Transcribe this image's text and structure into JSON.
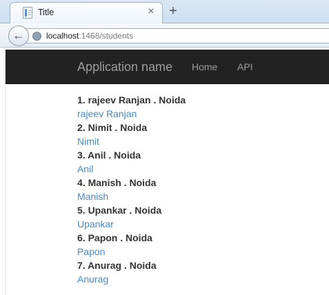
{
  "browser": {
    "tab_title": "Title",
    "tab_close": "×",
    "new_tab": "+",
    "back": "←",
    "url_host": "localhost",
    "url_rest": ":1468/students"
  },
  "navbar": {
    "brand": "Application name",
    "links": [
      "Home",
      "API"
    ]
  },
  "students": [
    {
      "title": "1. rajeev Ranjan . Noida",
      "link": "rajeev Ranjan"
    },
    {
      "title": "2. Nimit . Noida",
      "link": "Nimit"
    },
    {
      "title": "3. Anil . Noida",
      "link": "Anil"
    },
    {
      "title": "4. Manish . Noida",
      "link": "Manish"
    },
    {
      "title": "5. Upankar . Noida",
      "link": "Upankar"
    },
    {
      "title": "6. Papon . Noida",
      "link": "Papon"
    },
    {
      "title": "7. Anurag . Noida",
      "link": "Anurag"
    }
  ]
}
